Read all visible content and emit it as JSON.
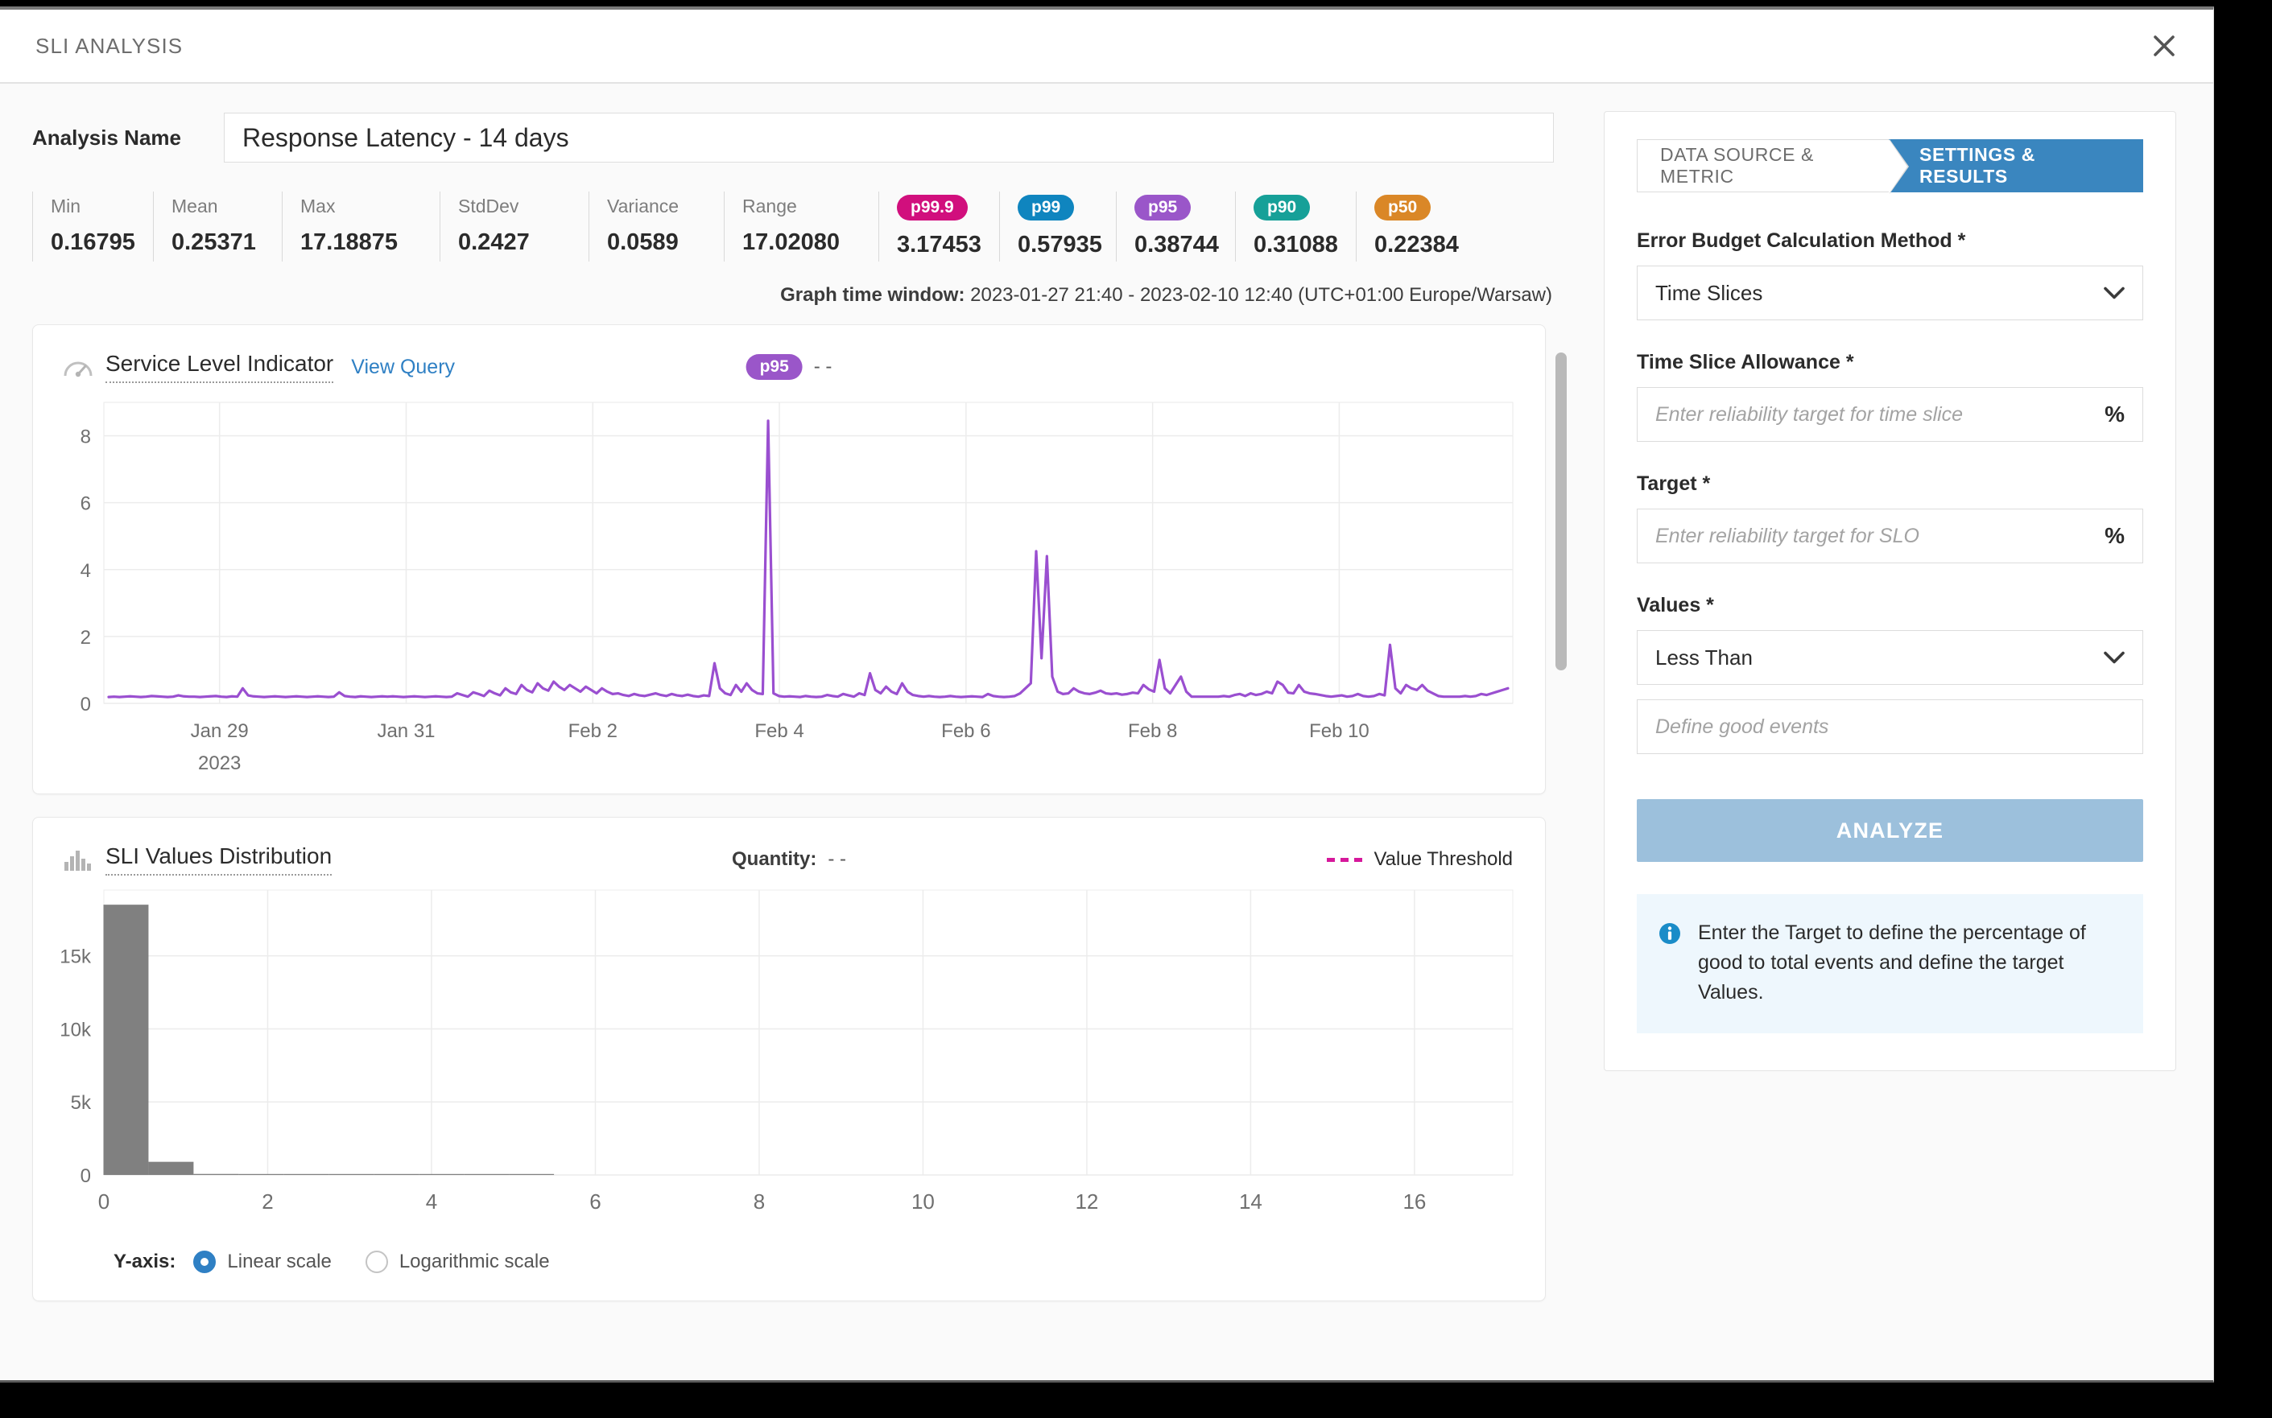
{
  "dialog": {
    "title": "SLI ANALYSIS",
    "close_icon": "close-icon"
  },
  "form": {
    "analysis_name_label": "Analysis Name",
    "analysis_name_value": "Response Latency - 14 days"
  },
  "stats": [
    {
      "label": "Min",
      "value": "0.16795",
      "badge": null,
      "badge_color": null
    },
    {
      "label": "Mean",
      "value": "0.25371",
      "badge": null,
      "badge_color": null
    },
    {
      "label": "Max",
      "value": "17.18875",
      "badge": null,
      "badge_color": null
    },
    {
      "label": "StdDev",
      "value": "0.2427",
      "badge": null,
      "badge_color": null
    },
    {
      "label": "Variance",
      "value": "0.0589",
      "badge": null,
      "badge_color": null
    },
    {
      "label": "Range",
      "value": "17.02080",
      "badge": null,
      "badge_color": null
    },
    {
      "label": "",
      "value": "3.17453",
      "badge": "p99.9",
      "badge_color": "#d10f7d"
    },
    {
      "label": "",
      "value": "0.57935",
      "badge": "p99",
      "badge_color": "#0f85bf"
    },
    {
      "label": "",
      "value": "0.38744",
      "badge": "p95",
      "badge_color": "#9a56c9"
    },
    {
      "label": "",
      "value": "0.31088",
      "badge": "p90",
      "badge_color": "#16a098"
    },
    {
      "label": "",
      "value": "0.22384",
      "badge": "p50",
      "badge_color": "#da8727"
    }
  ],
  "time_window": {
    "label": "Graph time window:",
    "value": "2023-01-27 21:40 - 2023-02-10 12:40 (UTC+01:00 Europe/Warsaw)"
  },
  "sli_card": {
    "icon": "gauge-icon",
    "title": "Service Level Indicator",
    "view_query": "View Query",
    "badge": "p95",
    "badge_color": "#9a56c9",
    "badge_value": "- -"
  },
  "dist_card": {
    "icon": "bar-chart-icon",
    "title": "SLI Values Distribution",
    "quantity_label": "Quantity:",
    "quantity_value": "- -",
    "legend_label": "Value Threshold",
    "legend_color": "#d6189b"
  },
  "yaxis_controls": {
    "caption": "Y-axis:",
    "options": [
      {
        "label": "Linear scale",
        "selected": true
      },
      {
        "label": "Logarithmic scale",
        "selected": false
      }
    ],
    "accent": "#2f80c4"
  },
  "panel": {
    "tabs": [
      {
        "label": "DATA SOURCE & METRIC",
        "active": false
      },
      {
        "label": "SETTINGS & RESULTS",
        "active": true
      }
    ],
    "tab_active_color": "#3a86bf",
    "fields": [
      {
        "label": "Error Budget Calculation Method *",
        "type": "select",
        "value": "Time Slices"
      },
      {
        "label": "Time Slice Allowance *",
        "type": "text",
        "placeholder": "Enter reliability target for time slice",
        "suffix": "%"
      },
      {
        "label": "Target *",
        "type": "text",
        "placeholder": "Enter reliability target for SLO",
        "suffix": "%"
      },
      {
        "label": "Values *",
        "type": "select",
        "value": "Less Than"
      },
      {
        "label": "",
        "type": "text",
        "placeholder": "Define good events",
        "suffix": ""
      }
    ],
    "analyze_label": "ANALYZE",
    "analyze_color": "#9cc0dc",
    "info_icon": "info-icon",
    "info_text": "Enter the Target to define the percentage of good to total events and define the target Values."
  },
  "chart_data": [
    {
      "type": "line",
      "title": "Service Level Indicator",
      "series_name": "p95",
      "color": "#9a4fd0",
      "xlabel": "",
      "ylabel": "",
      "ylim": [
        0,
        9
      ],
      "yticks": [
        0,
        2,
        4,
        6,
        8
      ],
      "xticks": [
        "Jan 29\n2023",
        "Jan 31",
        "Feb 2",
        "Feb 4",
        "Feb 6",
        "Feb 8",
        "Feb 10"
      ],
      "x_range": [
        "2023-01-27 21:40",
        "2023-02-10 12:40"
      ],
      "grid": true,
      "legend_position": "top-center",
      "values": [
        0.19,
        0.2,
        0.19,
        0.2,
        0.21,
        0.2,
        0.19,
        0.2,
        0.22,
        0.21,
        0.2,
        0.19,
        0.2,
        0.24,
        0.21,
        0.2,
        0.2,
        0.19,
        0.2,
        0.21,
        0.22,
        0.2,
        0.19,
        0.21,
        0.2,
        0.45,
        0.24,
        0.21,
        0.2,
        0.19,
        0.2,
        0.21,
        0.2,
        0.19,
        0.2,
        0.21,
        0.2,
        0.19,
        0.2,
        0.21,
        0.2,
        0.19,
        0.2,
        0.33,
        0.22,
        0.2,
        0.19,
        0.21,
        0.2,
        0.19,
        0.2,
        0.21,
        0.2,
        0.21,
        0.2,
        0.19,
        0.2,
        0.21,
        0.2,
        0.19,
        0.2,
        0.21,
        0.2,
        0.19,
        0.2,
        0.3,
        0.25,
        0.2,
        0.33,
        0.28,
        0.22,
        0.38,
        0.3,
        0.24,
        0.45,
        0.33,
        0.28,
        0.55,
        0.4,
        0.33,
        0.6,
        0.45,
        0.38,
        0.65,
        0.5,
        0.4,
        0.55,
        0.45,
        0.35,
        0.5,
        0.4,
        0.3,
        0.45,
        0.35,
        0.28,
        0.3,
        0.25,
        0.22,
        0.28,
        0.24,
        0.22,
        0.26,
        0.3,
        0.25,
        0.22,
        0.28,
        0.24,
        0.22,
        0.26,
        0.22,
        0.2,
        0.24,
        0.22,
        1.2,
        0.45,
        0.3,
        0.25,
        0.55,
        0.35,
        0.6,
        0.4,
        0.3,
        0.28,
        8.45,
        0.3,
        0.22,
        0.2,
        0.21,
        0.2,
        0.19,
        0.22,
        0.2,
        0.19,
        0.2,
        0.25,
        0.22,
        0.2,
        0.28,
        0.24,
        0.2,
        0.3,
        0.25,
        0.9,
        0.4,
        0.3,
        0.5,
        0.35,
        0.28,
        0.6,
        0.35,
        0.25,
        0.22,
        0.2,
        0.22,
        0.2,
        0.19,
        0.2,
        0.22,
        0.2,
        0.19,
        0.2,
        0.21,
        0.2,
        0.19,
        0.28,
        0.22,
        0.2,
        0.19,
        0.2,
        0.22,
        0.3,
        0.45,
        0.6,
        4.55,
        1.35,
        4.4,
        0.8,
        0.35,
        0.28,
        0.3,
        0.45,
        0.35,
        0.3,
        0.28,
        0.32,
        0.38,
        0.3,
        0.28,
        0.3,
        0.26,
        0.28,
        0.32,
        0.3,
        0.55,
        0.42,
        0.35,
        1.3,
        0.45,
        0.3,
        0.55,
        0.8,
        0.35,
        0.2,
        0.2,
        0.2,
        0.2,
        0.2,
        0.2,
        0.22,
        0.2,
        0.25,
        0.28,
        0.22,
        0.3,
        0.25,
        0.28,
        0.35,
        0.3,
        0.65,
        0.55,
        0.32,
        0.3,
        0.55,
        0.35,
        0.3,
        0.28,
        0.25,
        0.22,
        0.2,
        0.22,
        0.24,
        0.2,
        0.22,
        0.28,
        0.22,
        0.2,
        0.22,
        0.28,
        0.24,
        1.75,
        0.45,
        0.3,
        0.55,
        0.45,
        0.4,
        0.55,
        0.38,
        0.3,
        0.22,
        0.2,
        0.2,
        0.2,
        0.2,
        0.22,
        0.2,
        0.22,
        0.28,
        0.25,
        0.3,
        0.35,
        0.4,
        0.45
      ]
    },
    {
      "type": "bar",
      "title": "SLI Values Distribution",
      "bar_color": "#808080",
      "xlabel": "",
      "ylabel": "",
      "ylim": [
        0,
        19500
      ],
      "yticks": [
        0,
        5000,
        10000,
        15000
      ],
      "ytick_labels": [
        "0",
        "5k",
        "10k",
        "15k"
      ],
      "xticks": [
        0,
        2,
        4,
        6,
        8,
        10,
        12,
        14,
        16
      ],
      "xlim": [
        0,
        17.2
      ],
      "grid": true,
      "bin_centers": [
        0.27,
        0.82,
        1.37,
        1.92,
        2.47,
        3.02,
        3.57,
        4.12,
        4.67,
        5.22
      ],
      "bin_width": 0.55,
      "values": [
        18500,
        900,
        70,
        35,
        12,
        6,
        4,
        3,
        2,
        1
      ]
    }
  ]
}
